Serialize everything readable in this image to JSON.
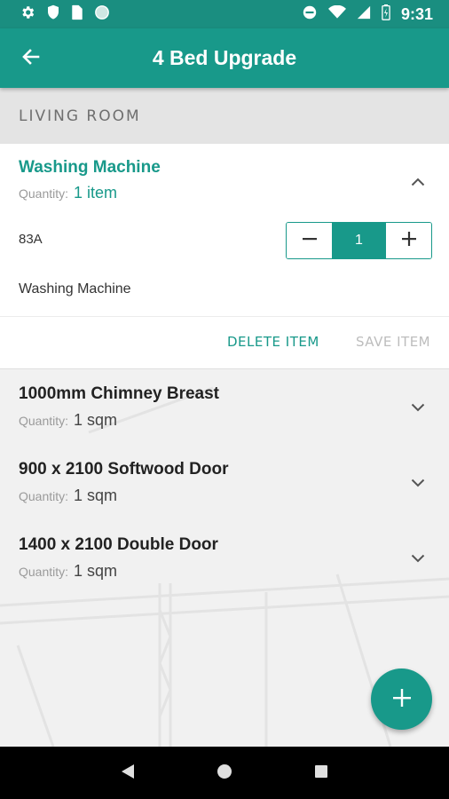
{
  "status_bar": {
    "time": "9:31",
    "left_icons": [
      "gear-icon",
      "shield-icon",
      "sim-card-icon",
      "circle-icon"
    ],
    "right_icons": [
      "do-not-disturb-icon",
      "wifi-icon",
      "signal-icon",
      "battery-icon"
    ]
  },
  "app_bar": {
    "title": "4 Bed Upgrade",
    "back_icon": "arrow-back-icon"
  },
  "section": {
    "label": "LIVING ROOM"
  },
  "expanded_item": {
    "title": "Washing Machine",
    "quantity_label": "Quantity:",
    "quantity_value": "1 item",
    "code": "83A",
    "description": "Washing Machine",
    "stepper": {
      "value": "1",
      "minus_icon": "minus-icon",
      "plus_icon": "plus-icon"
    },
    "delete_label": "DELETE ITEM",
    "save_label": "SAVE ITEM"
  },
  "items": [
    {
      "title": "1000mm Chimney Breast",
      "quantity_label": "Quantity:",
      "quantity_value": "1 sqm"
    },
    {
      "title": "900 x 2100 Softwood Door",
      "quantity_label": "Quantity:",
      "quantity_value": "1 sqm"
    },
    {
      "title": "1400 x 2100 Double Door",
      "quantity_label": "Quantity:",
      "quantity_value": "1 sqm"
    }
  ],
  "fab": {
    "icon": "plus-icon"
  },
  "nav_bar": {
    "icons": [
      "back-triangle-icon",
      "home-circle-icon",
      "recents-square-icon"
    ]
  },
  "colors": {
    "primary": "#18998a",
    "status_bar": "#1a8e80",
    "section_bg": "#e4e4e4",
    "disabled_text": "#bdbdbd"
  }
}
